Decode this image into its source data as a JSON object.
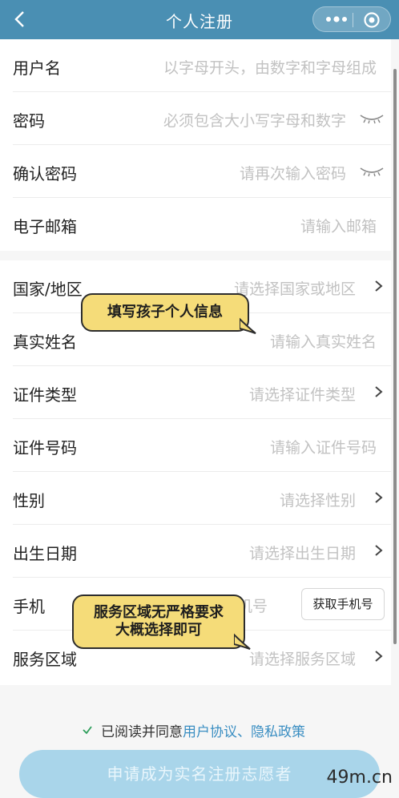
{
  "nav": {
    "title": "个人注册"
  },
  "account_fields": [
    {
      "label": "用户名",
      "placeholder": "以字母开头，由数字和字母组成"
    },
    {
      "label": "密码",
      "placeholder": "必须包含大小写字母和数字"
    },
    {
      "label": "确认密码",
      "placeholder": "请再次输入密码"
    },
    {
      "label": "电子邮箱",
      "placeholder": "请输入邮箱"
    }
  ],
  "profile_fields": [
    {
      "label": "国家/地区",
      "placeholder": "请选择国家或地区"
    },
    {
      "label": "真实姓名",
      "placeholder": "请输入真实姓名"
    },
    {
      "label": "证件类型",
      "placeholder": "请选择证件类型"
    },
    {
      "label": "证件号码",
      "placeholder": "请输入证件号码"
    },
    {
      "label": "性别",
      "placeholder": "请选择性别"
    },
    {
      "label": "出生日期",
      "placeholder": "请选择出生日期"
    },
    {
      "label": "手机",
      "placeholder": "机号",
      "button": "获取手机号"
    },
    {
      "label": "服务区域",
      "placeholder": "请选择服务区域"
    }
  ],
  "agreement": {
    "prefix": "已阅读并同意",
    "links": "用户协议、隐私政策"
  },
  "submit_label": "申请成为实名注册志愿者",
  "annotations": {
    "bubble_1": "填写孩子个人信息",
    "bubble_2_line1": "服务区域无严格要求",
    "bubble_2_line2": "大概选择即可"
  },
  "watermark": "49m.cn",
  "colors": {
    "header": "#4a8fb3",
    "submit": "#a9d5ea",
    "link": "#3a8ec2",
    "bubble": "#f5dc79"
  }
}
